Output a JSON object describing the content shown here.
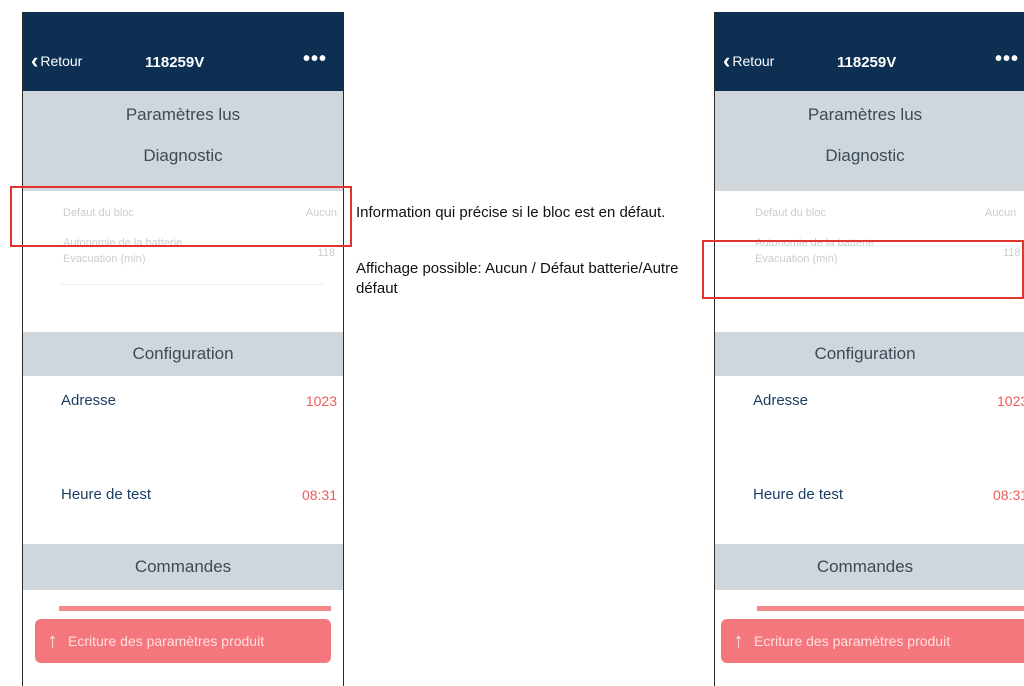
{
  "phone": {
    "back_label": "Retour",
    "title": "118259V",
    "more_label": "•••",
    "section_read": "Paramètres lus",
    "section_diag": "Diagnostic",
    "defaut_label": "Defaut du bloc",
    "defaut_value": "Aucun",
    "autonomie_label_line1": "Autonomie de la batterie",
    "autonomie_label_line2": "Evacuation (min)",
    "autonomie_value": "118",
    "section_config": "Configuration",
    "adresse_label": "Adresse",
    "adresse_value": "1023",
    "heure_label": "Heure de test",
    "heure_value": "08:31",
    "section_commands": "Commandes",
    "write_button": "Ecriture des paramètres produit"
  },
  "annotation": {
    "line1": "Information qui précise si le bloc est en défaut.",
    "line2": "Affichage possible:  Aucun / Défaut batterie/Autre défaut"
  },
  "colors": {
    "navbar": "#0c2f52",
    "band": "#cfd6dc",
    "highlight": "#e0342f",
    "value_red": "#f05a5a",
    "button": "#f4777d"
  }
}
